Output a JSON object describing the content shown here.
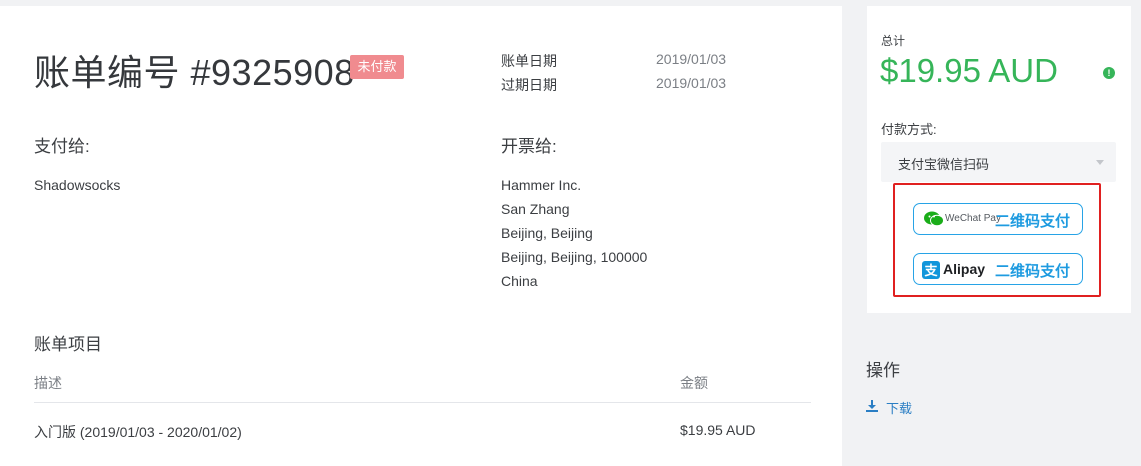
{
  "invoice": {
    "title": "账单编号 #9325908",
    "status_badge": "未付款",
    "invoice_date_label": "账单日期",
    "invoice_date_value": "2019/01/03",
    "due_date_label": "过期日期",
    "due_date_value": "2019/01/03",
    "pay_to_heading": "支付给:",
    "pay_to_name": "Shadowsocks",
    "bill_to_heading": "开票给:",
    "bill_to_lines": [
      "Hammer Inc.",
      "San Zhang",
      "Beijing, Beijing",
      "Beijing, Beijing, 100000",
      "China"
    ],
    "items_heading": "账单项目",
    "items_columns": [
      "描述",
      "金额"
    ],
    "items_rows": [
      {
        "description": "入门版 (2019/01/03 - 2020/01/02)",
        "amount": "$19.95 AUD"
      }
    ]
  },
  "payment": {
    "total_label": "总计",
    "total_amount": "$19.95 AUD",
    "method_label": "付款方式:",
    "method_selected": "支付宝微信扫码",
    "wechat_button": {
      "brand": "WeChat Pay",
      "label": "二维码支付",
      "icon": "wechat-pay-icon",
      "color": "#1aad19"
    },
    "alipay_button": {
      "brand": "Alipay",
      "label": "二维码支付",
      "icon": "alipay-icon",
      "color": "#1296db"
    },
    "accent_color": "#36b559",
    "highlight_color": "#e02020"
  },
  "actions": {
    "heading": "操作",
    "download_label": "下载",
    "download_icon": "download-icon"
  }
}
